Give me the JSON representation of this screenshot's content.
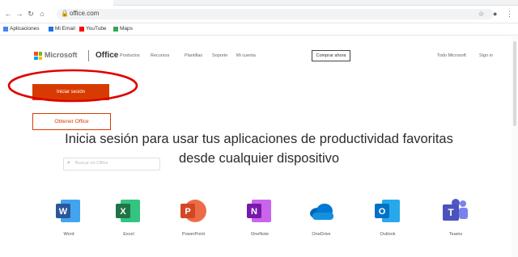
{
  "browser": {
    "url": "office.com",
    "bookmarks": [
      {
        "label": "Aplicaciones",
        "color": "#4285f4"
      },
      {
        "label": "Mi Email",
        "color": "#1a73e8"
      },
      {
        "label": "YouTube",
        "color": "#ff0000"
      },
      {
        "label": "Maps",
        "color": "#34a853"
      }
    ]
  },
  "header": {
    "brand": "Microsoft",
    "product": "Office",
    "nav": [
      "Productos",
      "Recursos",
      "Plantillas",
      "Soporte",
      "Mi cuenta"
    ],
    "buy_label": "Comprar ahora",
    "all_microsoft": "Todo Microsoft",
    "sign_in": "Sign in"
  },
  "hero": {
    "signin_label": "Iniciar sesión",
    "get_office_label": "Obtener Office",
    "headline_line1": "Inicia sesión para usar tus aplicaciones de productividad favoritas",
    "headline_line2": "desde cualquier dispositivo",
    "search_placeholder": "Buscar en Office"
  },
  "apps": [
    {
      "label": "Word",
      "icon": "word-icon",
      "color": "#2b579a",
      "letter": "W"
    },
    {
      "label": "Excel",
      "icon": "excel-icon",
      "color": "#217346",
      "letter": "X"
    },
    {
      "label": "PowerPoint",
      "icon": "powerpoint-icon",
      "color": "#d24726",
      "letter": "P"
    },
    {
      "label": "OneNote",
      "icon": "onenote-icon",
      "color": "#7719aa",
      "letter": "N"
    },
    {
      "label": "OneDrive",
      "icon": "onedrive-icon",
      "color": "#0364b8",
      "letter": ""
    },
    {
      "label": "Outlook",
      "icon": "outlook-icon",
      "color": "#0072c6",
      "letter": "O"
    },
    {
      "label": "Teams",
      "icon": "teams-icon",
      "color": "#5059c9",
      "letter": "T"
    }
  ],
  "annotation": {
    "color": "#e00000"
  }
}
